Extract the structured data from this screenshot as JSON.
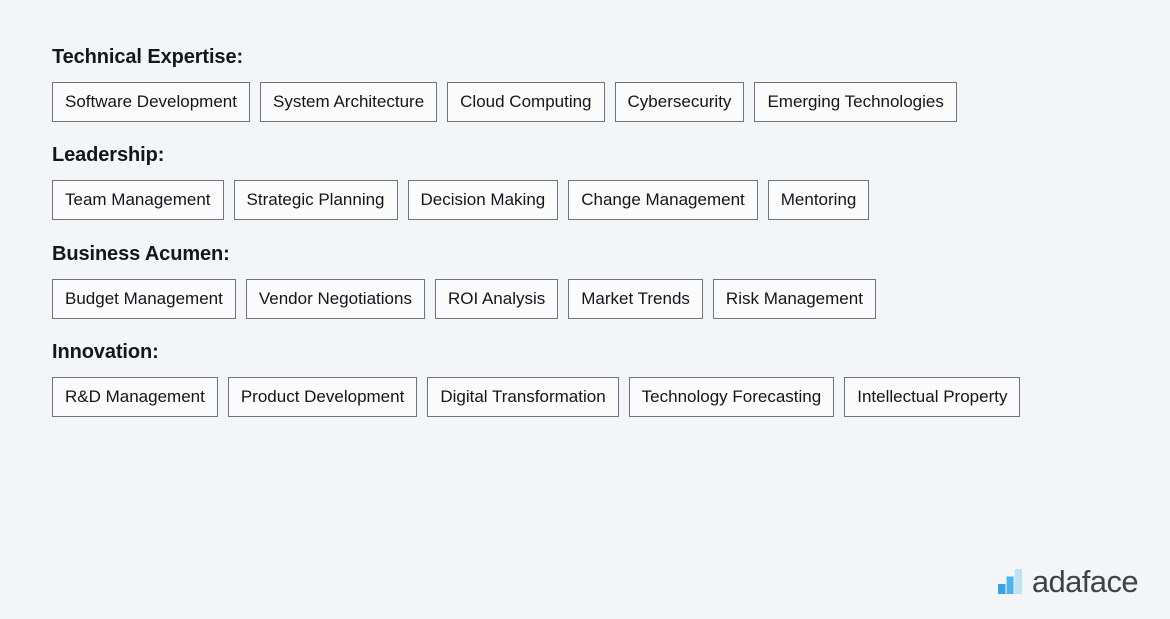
{
  "page": {
    "background_color": "#f4f5f7",
    "text_color": "#14161a"
  },
  "sections": [
    {
      "heading": "Technical Expertise:",
      "tags": [
        "Software Development",
        "System Architecture",
        "Cloud Computing",
        "Cybersecurity",
        "Emerging Technologies"
      ]
    },
    {
      "heading": "Leadership:",
      "tags": [
        "Team Management",
        "Strategic Planning",
        "Decision Making",
        "Change Management",
        "Mentoring"
      ]
    },
    {
      "heading": "Business Acumen:",
      "tags": [
        "Budget Management",
        "Vendor Negotiations",
        "ROI Analysis",
        "Market Trends",
        "Risk Management"
      ]
    },
    {
      "heading": "Innovation:",
      "tags": [
        "R&D Management",
        "Product Development",
        "Digital Transformation",
        "Technology Forecasting",
        "Intellectual Property"
      ]
    }
  ],
  "logo": {
    "icon": "bar-chart-icon",
    "wordmark": "adaface",
    "wordmark_color": "#3f4246",
    "bar_colors": [
      "#3aa3e3",
      "#4cb4ef",
      "#bfe0f5"
    ]
  },
  "tag_style": {
    "border_color": "#6b7280",
    "fill_color": "#fbfbfc"
  }
}
